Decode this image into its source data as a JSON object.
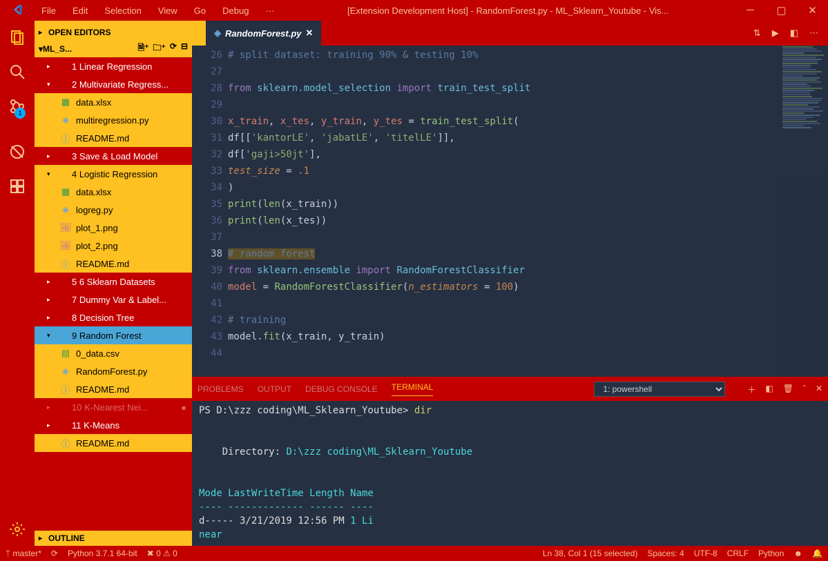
{
  "titlebar": {
    "menus": [
      "File",
      "Edit",
      "Selection",
      "View",
      "Go",
      "Debug",
      "···"
    ],
    "title": "[Extension Development Host] - RandomForest.py - ML_Sklearn_Youtube - Vis..."
  },
  "activitybar": {
    "badge": "1"
  },
  "sidebar": {
    "open_editors": "OPEN EDITORS",
    "project": "ML_S...",
    "outline": "OUTLINE",
    "tree": [
      {
        "type": "folder",
        "label": "1 Linear Regression"
      },
      {
        "type": "folder",
        "label": "2 Multivariate Regress...",
        "open": true
      },
      {
        "type": "file",
        "label": "data.xlsx",
        "icon": "xlsx",
        "cls": "open"
      },
      {
        "type": "file",
        "label": "multiregression.py",
        "icon": "py",
        "cls": "open"
      },
      {
        "type": "file",
        "label": "README.md",
        "icon": "md",
        "cls": "open"
      },
      {
        "type": "folder",
        "label": "3 Save & Load Model"
      },
      {
        "type": "folder",
        "label": "4 Logistic Regression",
        "open": true,
        "cls": "open"
      },
      {
        "type": "file",
        "label": "data.xlsx",
        "icon": "xlsx",
        "cls": "open"
      },
      {
        "type": "file",
        "label": "logreg.py",
        "icon": "py",
        "cls": "open"
      },
      {
        "type": "file",
        "label": "plot_1.png",
        "icon": "img",
        "cls": "open"
      },
      {
        "type": "file",
        "label": "plot_2.png",
        "icon": "img",
        "cls": "open"
      },
      {
        "type": "file",
        "label": "README.md",
        "icon": "md",
        "cls": "open"
      },
      {
        "type": "folder",
        "label": "5 6 Sklearn Datasets"
      },
      {
        "type": "folder",
        "label": "7 Dummy Var & Label..."
      },
      {
        "type": "folder",
        "label": "8 Decision Tree"
      },
      {
        "type": "folder",
        "label": "9 Random Forest",
        "open": true,
        "cls": "selected"
      },
      {
        "type": "file",
        "label": "0_data.csv",
        "icon": "csv",
        "cls": "open"
      },
      {
        "type": "file",
        "label": "RandomForest.py",
        "icon": "py",
        "cls": "open"
      },
      {
        "type": "file",
        "label": "README.md",
        "icon": "md",
        "cls": "open"
      },
      {
        "type": "folder",
        "label": "10 K-Nearest Nei...",
        "cls": "modified",
        "dot": "●"
      },
      {
        "type": "folder",
        "label": "11 K-Means"
      },
      {
        "type": "file",
        "label": "README.md",
        "icon": "md",
        "cls": "open",
        "indent": "file2"
      }
    ]
  },
  "tab": {
    "label": "RandomForest.py"
  },
  "code": {
    "start": 26,
    "cur": 38,
    "lines": [
      "# split dataset: training 90% & testing 10%",
      "",
      "from sklearn.model_selection import train_test_split",
      "",
      "x_train, x_tes, y_train, y_tes = train_test_split(",
      "    df[['kantorLE', 'jabatLE', 'titelLE']],",
      "    df['gaji>50jt'],",
      "    test_size = .1",
      ")",
      "print(len(x_train))",
      "print(len(x_tes))",
      "",
      "# random forest",
      "from sklearn.ensemble import RandomForestClassifier",
      "model = RandomForestClassifier(n_estimators = 100)",
      "",
      "# training",
      "model.fit(x_train, y_train)",
      ""
    ]
  },
  "panel": {
    "tabs": [
      "PROBLEMS",
      "OUTPUT",
      "DEBUG CONSOLE",
      "TERMINAL"
    ],
    "active": "TERMINAL",
    "shell": "1: powershell",
    "term_lines": [
      {
        "pre": "PS D:\\zzz coding\\ML_Sklearn_Youtube> ",
        "cmd": "dir"
      },
      "",
      "",
      "    Directory: D:\\zzz coding\\ML_Sklearn_Youtube",
      "",
      "",
      "Mode                LastWriteTime         Length Name",
      "----                -------------         ------ ----",
      "d-----        3/21/2019  12:56 PM              1 Li",
      "                                                near"
    ]
  },
  "status": {
    "branch": "master*",
    "sync": "⟳",
    "python": "Python 3.7.1 64-bit",
    "err": "✖ 0",
    "warn": "⚠ 0",
    "lncol": "Ln 38, Col 1 (15 selected)",
    "spaces": "Spaces: 4",
    "enc": "UTF-8",
    "eol": "CRLF",
    "lang": "Python"
  }
}
